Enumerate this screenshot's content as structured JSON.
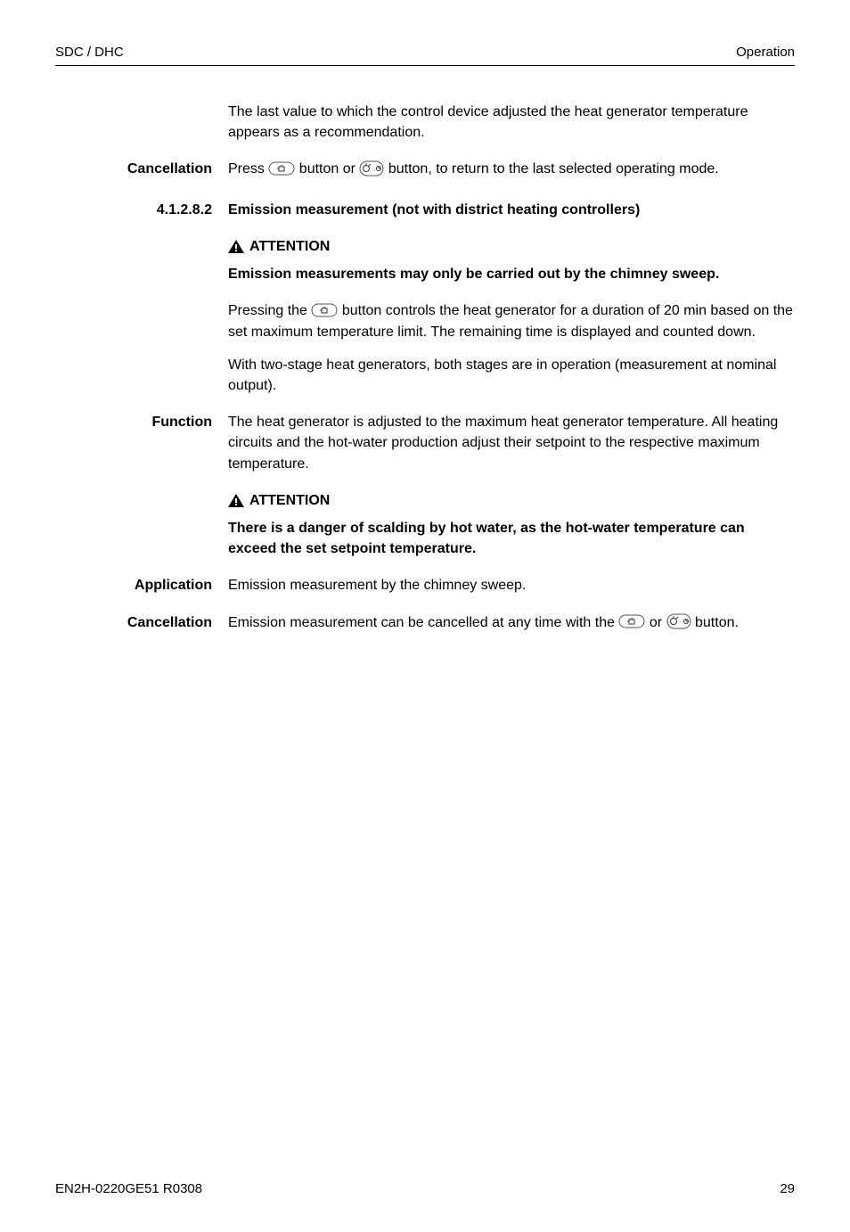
{
  "header": {
    "left": "SDC / DHC",
    "right": "Operation"
  },
  "intro": {
    "p1_a": "The last value to which the control device adjusted the heat generator temperature appears as a recommendation."
  },
  "cancellation1": {
    "label": "Cancellation",
    "text_a": "Press ",
    "text_b": " button or ",
    "text_c": " button, to return to the last selected operating mode."
  },
  "section": {
    "num": "4.1.2.8.2",
    "title": "Emission measurement (not with district heating controllers)"
  },
  "attention1": {
    "label": "ATTENTION",
    "bold": "Emission measurements may only be carried out by the chimney sweep."
  },
  "emission_body": {
    "p1_a": "Pressing the ",
    "p1_b": " button controls the heat generator for a duration of 20 min based on the set maximum temperature limit. The remaining time is displayed and counted down.",
    "p2": "With two-stage heat generators, both stages are in operation (measurement at nominal output)."
  },
  "function": {
    "label": "Function",
    "text": "The heat generator is adjusted to the maximum heat generator temperature. All heating circuits and the hot-water production adjust their setpoint to the respective maximum temperature."
  },
  "attention2": {
    "label": "ATTENTION",
    "bold": "There is a danger of scalding by hot water, as the hot-water temperature can exceed the set setpoint temperature."
  },
  "application": {
    "label": "Application",
    "text": "Emission measurement by the chimney sweep."
  },
  "cancellation2": {
    "label": "Cancellation",
    "text_a": "Emission measurement can be cancelled at any time with the ",
    "text_b": " or ",
    "text_c": " button."
  },
  "footer": {
    "left": "EN2H-0220GE51 R0308",
    "right": "29"
  }
}
